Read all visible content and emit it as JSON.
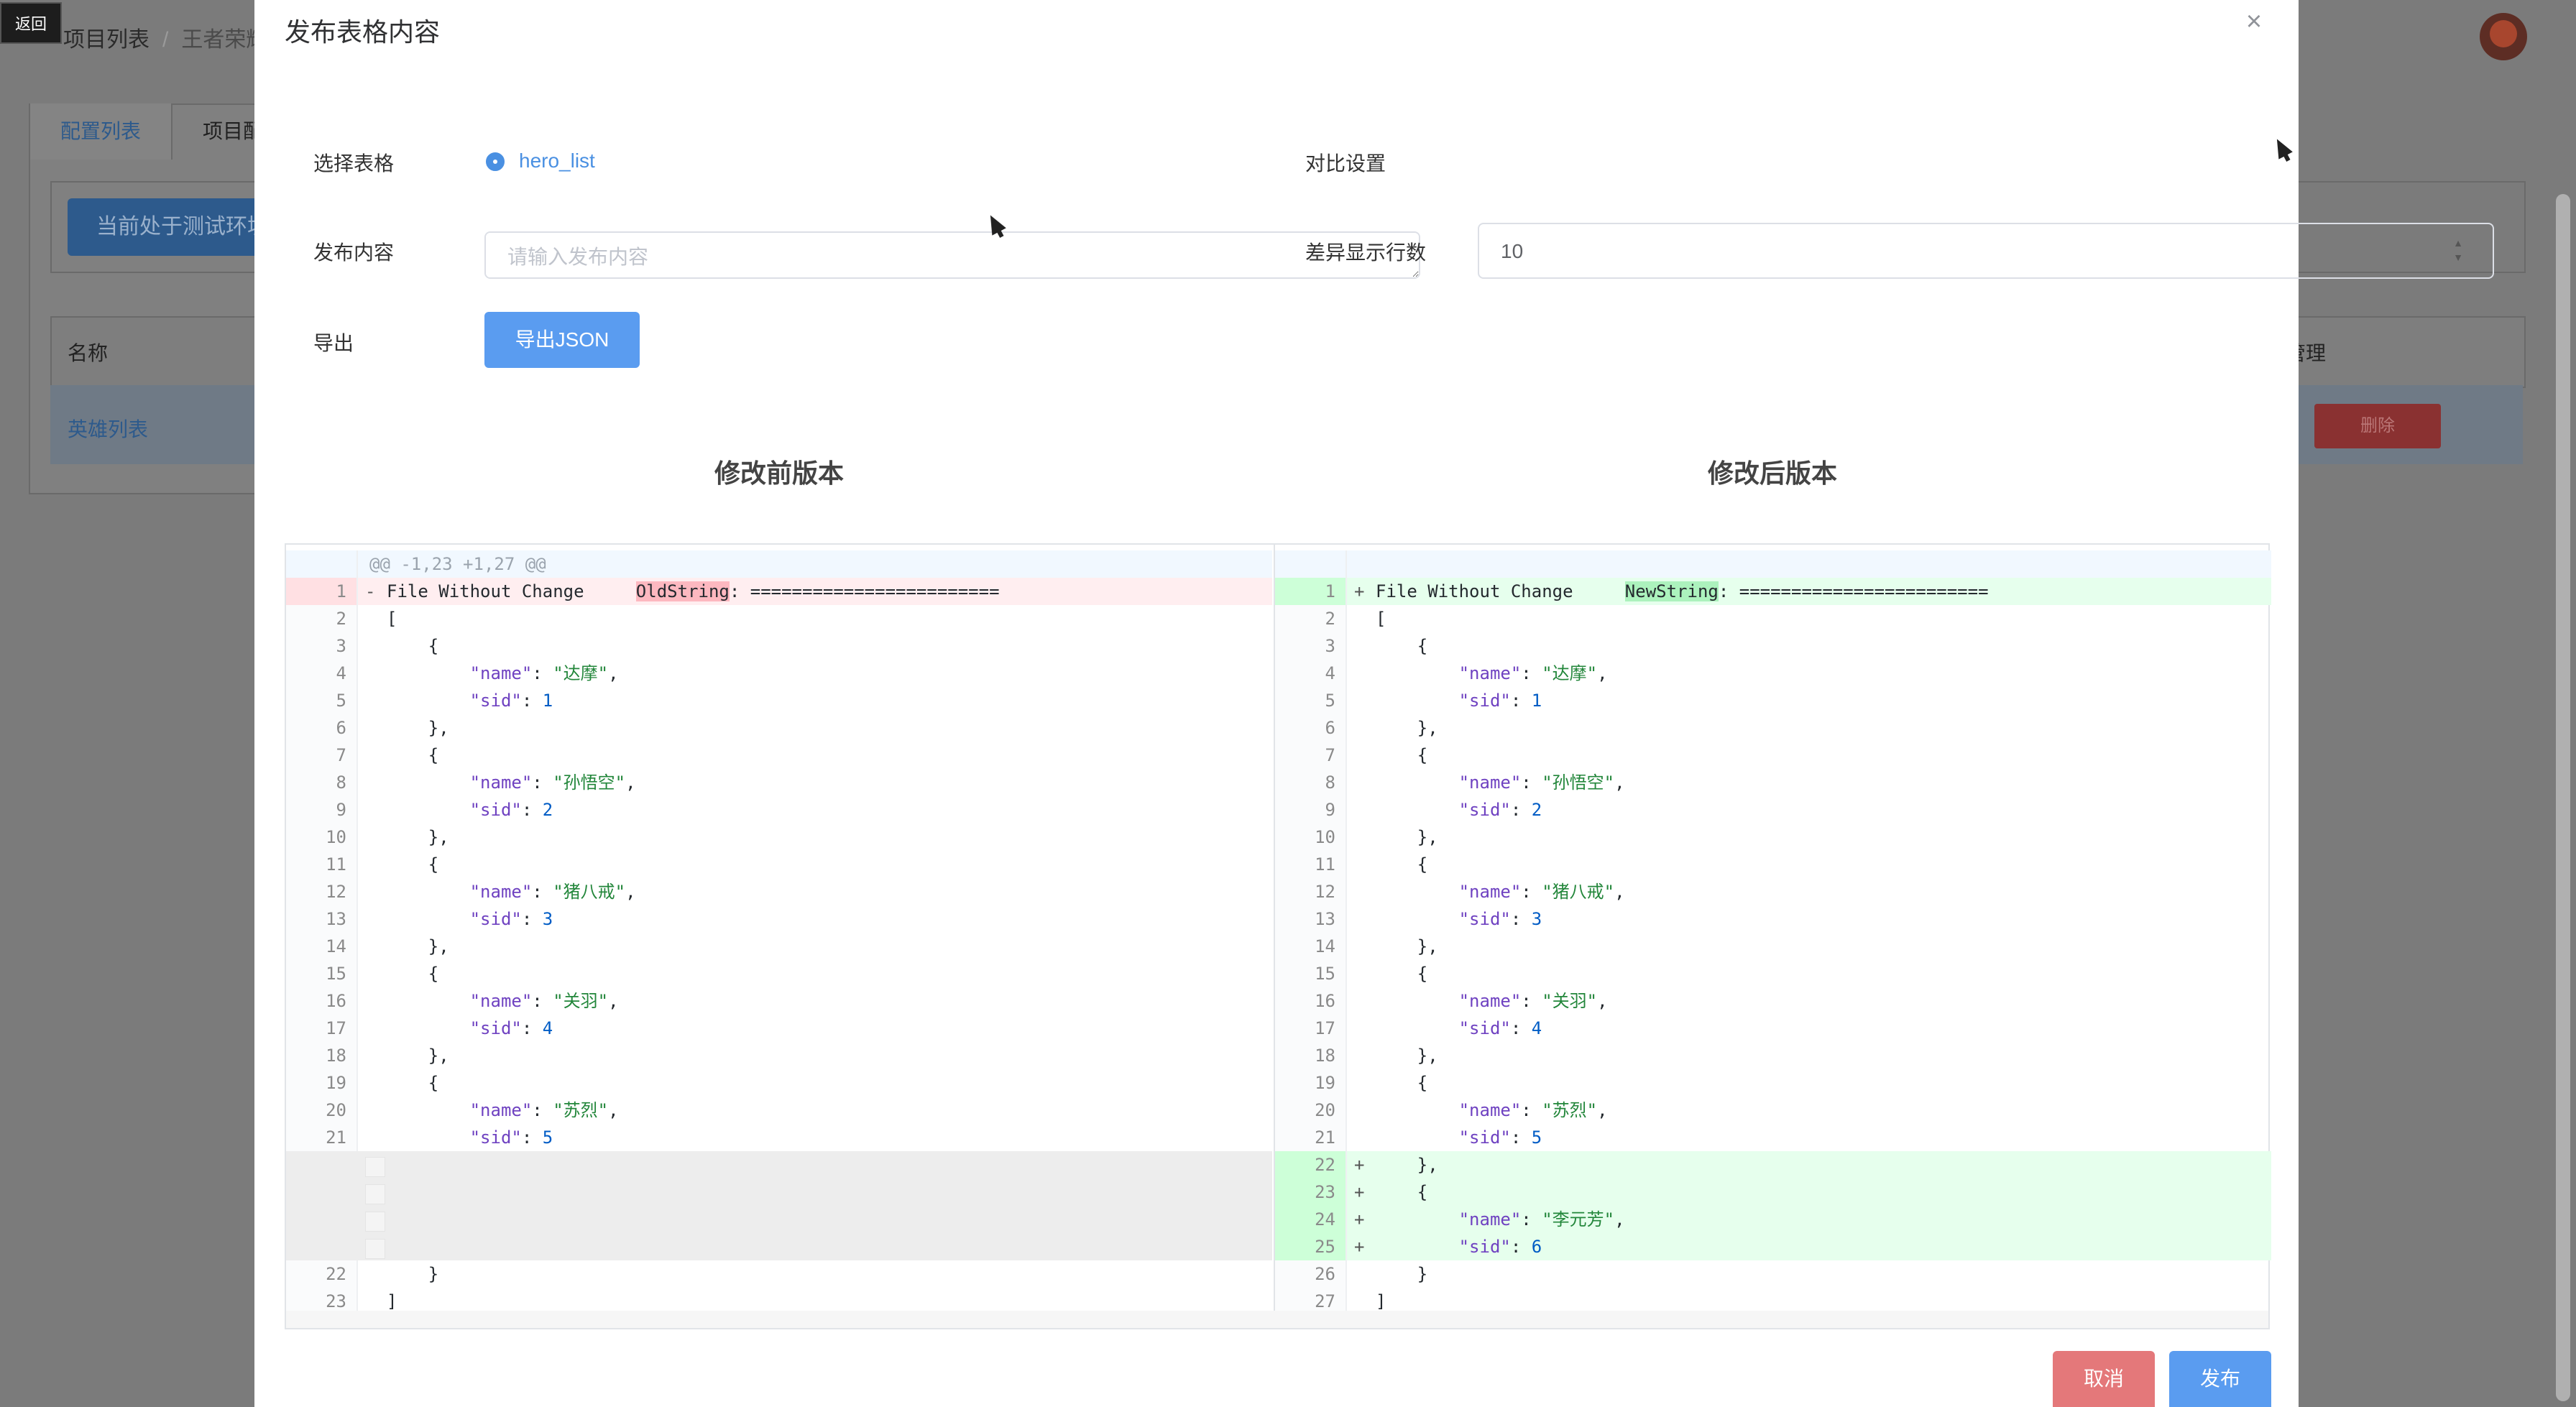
{
  "background": {
    "back_label": "返回",
    "breadcrumb": {
      "first": "项目列表",
      "separator": "/",
      "current": "王者荣耀"
    },
    "tabs": [
      "配置列表",
      "项目配置"
    ],
    "env_button": "当前处于测试环境",
    "table": {
      "col_name": "名称",
      "col_manage": "管理",
      "row_name": "英雄列表",
      "delete_label": "删除"
    }
  },
  "modal": {
    "title": "发布表格内容",
    "close_icon": "close-icon",
    "labels": {
      "select_table": "选择表格",
      "compare_settings": "对比设置",
      "publish_content": "发布内容",
      "diff_lines": "差异显示行数",
      "export": "导出"
    },
    "selected_table": "hero_list",
    "publish_content": {
      "value": "",
      "placeholder": "请输入发布内容"
    },
    "diff_lines_value": "10",
    "export_button": "导出JSON",
    "before_title": "修改前版本",
    "after_title": "修改后版本",
    "cancel_button": "取消",
    "publish_button": "发布"
  },
  "diff": {
    "hunk_header": "@@ -1,23 +1,27 @@",
    "left": [
      {
        "n": "1",
        "t": "del",
        "m": "-",
        "parts": [
          [
            "",
            "File "
          ],
          [
            "",
            "Without Change     "
          ],
          [
            "hl-del",
            "OldString"
          ],
          [
            "",
            ": ========================"
          ]
        ]
      },
      {
        "n": "2",
        "t": "ctx",
        "parts": [
          [
            "",
            "["
          ]
        ]
      },
      {
        "n": "3",
        "t": "ctx",
        "parts": [
          [
            "",
            "    {"
          ]
        ]
      },
      {
        "n": "4",
        "t": "ctx",
        "parts": [
          [
            "",
            "        "
          ],
          [
            "k",
            "\"name\""
          ],
          [
            "",
            ": "
          ],
          [
            "s",
            "\"达摩\""
          ],
          [
            "",
            ","
          ]
        ]
      },
      {
        "n": "5",
        "t": "ctx",
        "parts": [
          [
            "",
            "        "
          ],
          [
            "k",
            "\"sid\""
          ],
          [
            "",
            ": "
          ],
          [
            "n",
            "1"
          ]
        ]
      },
      {
        "n": "6",
        "t": "ctx",
        "parts": [
          [
            "",
            "    },"
          ]
        ]
      },
      {
        "n": "7",
        "t": "ctx",
        "parts": [
          [
            "",
            "    {"
          ]
        ]
      },
      {
        "n": "8",
        "t": "ctx",
        "parts": [
          [
            "",
            "        "
          ],
          [
            "k",
            "\"name\""
          ],
          [
            "",
            ": "
          ],
          [
            "s",
            "\"孙悟空\""
          ],
          [
            "",
            ","
          ]
        ]
      },
      {
        "n": "9",
        "t": "ctx",
        "parts": [
          [
            "",
            "        "
          ],
          [
            "k",
            "\"sid\""
          ],
          [
            "",
            ": "
          ],
          [
            "n",
            "2"
          ]
        ]
      },
      {
        "n": "10",
        "t": "ctx",
        "parts": [
          [
            "",
            "    },"
          ]
        ]
      },
      {
        "n": "11",
        "t": "ctx",
        "parts": [
          [
            "",
            "    {"
          ]
        ]
      },
      {
        "n": "12",
        "t": "ctx",
        "parts": [
          [
            "",
            "        "
          ],
          [
            "k",
            "\"name\""
          ],
          [
            "",
            ": "
          ],
          [
            "s",
            "\"猪八戒\""
          ],
          [
            "",
            ","
          ]
        ]
      },
      {
        "n": "13",
        "t": "ctx",
        "parts": [
          [
            "",
            "        "
          ],
          [
            "k",
            "\"sid\""
          ],
          [
            "",
            ": "
          ],
          [
            "n",
            "3"
          ]
        ]
      },
      {
        "n": "14",
        "t": "ctx",
        "parts": [
          [
            "",
            "    },"
          ]
        ]
      },
      {
        "n": "15",
        "t": "ctx",
        "parts": [
          [
            "",
            "    {"
          ]
        ]
      },
      {
        "n": "16",
        "t": "ctx",
        "parts": [
          [
            "",
            "        "
          ],
          [
            "k",
            "\"name\""
          ],
          [
            "",
            ": "
          ],
          [
            "s",
            "\"关羽\""
          ],
          [
            "",
            ","
          ]
        ]
      },
      {
        "n": "17",
        "t": "ctx",
        "parts": [
          [
            "",
            "        "
          ],
          [
            "k",
            "\"sid\""
          ],
          [
            "",
            ": "
          ],
          [
            "n",
            "4"
          ]
        ]
      },
      {
        "n": "18",
        "t": "ctx",
        "parts": [
          [
            "",
            "    },"
          ]
        ]
      },
      {
        "n": "19",
        "t": "ctx",
        "parts": [
          [
            "",
            "    {"
          ]
        ]
      },
      {
        "n": "20",
        "t": "ctx",
        "parts": [
          [
            "",
            "        "
          ],
          [
            "k",
            "\"name\""
          ],
          [
            "",
            ": "
          ],
          [
            "s",
            "\"苏烈\""
          ],
          [
            "",
            ","
          ]
        ]
      },
      {
        "n": "21",
        "t": "ctx",
        "parts": [
          [
            "",
            "        "
          ],
          [
            "k",
            "\"sid\""
          ],
          [
            "",
            ": "
          ],
          [
            "n",
            "5"
          ]
        ]
      },
      {
        "n": "",
        "t": "empty",
        "parts": []
      },
      {
        "n": "",
        "t": "empty",
        "parts": []
      },
      {
        "n": "",
        "t": "empty",
        "parts": []
      },
      {
        "n": "",
        "t": "empty",
        "parts": []
      },
      {
        "n": "22",
        "t": "ctx",
        "parts": [
          [
            "",
            "    }"
          ]
        ]
      },
      {
        "n": "23",
        "t": "ctx",
        "parts": [
          [
            "",
            "]"
          ]
        ]
      }
    ],
    "right": [
      {
        "n": "1",
        "t": "add",
        "m": "+",
        "parts": [
          [
            "",
            "File "
          ],
          [
            "",
            "Without Change     "
          ],
          [
            "hl-add",
            "NewString"
          ],
          [
            "",
            ": ========================"
          ]
        ]
      },
      {
        "n": "2",
        "t": "ctx",
        "parts": [
          [
            "",
            "["
          ]
        ]
      },
      {
        "n": "3",
        "t": "ctx",
        "parts": [
          [
            "",
            "    {"
          ]
        ]
      },
      {
        "n": "4",
        "t": "ctx",
        "parts": [
          [
            "",
            "        "
          ],
          [
            "k",
            "\"name\""
          ],
          [
            "",
            ": "
          ],
          [
            "s",
            "\"达摩\""
          ],
          [
            "",
            ","
          ]
        ]
      },
      {
        "n": "5",
        "t": "ctx",
        "parts": [
          [
            "",
            "        "
          ],
          [
            "k",
            "\"sid\""
          ],
          [
            "",
            ": "
          ],
          [
            "n",
            "1"
          ]
        ]
      },
      {
        "n": "6",
        "t": "ctx",
        "parts": [
          [
            "",
            "    },"
          ]
        ]
      },
      {
        "n": "7",
        "t": "ctx",
        "parts": [
          [
            "",
            "    {"
          ]
        ]
      },
      {
        "n": "8",
        "t": "ctx",
        "parts": [
          [
            "",
            "        "
          ],
          [
            "k",
            "\"name\""
          ],
          [
            "",
            ": "
          ],
          [
            "s",
            "\"孙悟空\""
          ],
          [
            "",
            ","
          ]
        ]
      },
      {
        "n": "9",
        "t": "ctx",
        "parts": [
          [
            "",
            "        "
          ],
          [
            "k",
            "\"sid\""
          ],
          [
            "",
            ": "
          ],
          [
            "n",
            "2"
          ]
        ]
      },
      {
        "n": "10",
        "t": "ctx",
        "parts": [
          [
            "",
            "    },"
          ]
        ]
      },
      {
        "n": "11",
        "t": "ctx",
        "parts": [
          [
            "",
            "    {"
          ]
        ]
      },
      {
        "n": "12",
        "t": "ctx",
        "parts": [
          [
            "",
            "        "
          ],
          [
            "k",
            "\"name\""
          ],
          [
            "",
            ": "
          ],
          [
            "s",
            "\"猪八戒\""
          ],
          [
            "",
            ","
          ]
        ]
      },
      {
        "n": "13",
        "t": "ctx",
        "parts": [
          [
            "",
            "        "
          ],
          [
            "k",
            "\"sid\""
          ],
          [
            "",
            ": "
          ],
          [
            "n",
            "3"
          ]
        ]
      },
      {
        "n": "14",
        "t": "ctx",
        "parts": [
          [
            "",
            "    },"
          ]
        ]
      },
      {
        "n": "15",
        "t": "ctx",
        "parts": [
          [
            "",
            "    {"
          ]
        ]
      },
      {
        "n": "16",
        "t": "ctx",
        "parts": [
          [
            "",
            "        "
          ],
          [
            "k",
            "\"name\""
          ],
          [
            "",
            ": "
          ],
          [
            "s",
            "\"关羽\""
          ],
          [
            "",
            ","
          ]
        ]
      },
      {
        "n": "17",
        "t": "ctx",
        "parts": [
          [
            "",
            "        "
          ],
          [
            "k",
            "\"sid\""
          ],
          [
            "",
            ": "
          ],
          [
            "n",
            "4"
          ]
        ]
      },
      {
        "n": "18",
        "t": "ctx",
        "parts": [
          [
            "",
            "    },"
          ]
        ]
      },
      {
        "n": "19",
        "t": "ctx",
        "parts": [
          [
            "",
            "    {"
          ]
        ]
      },
      {
        "n": "20",
        "t": "ctx",
        "parts": [
          [
            "",
            "        "
          ],
          [
            "k",
            "\"name\""
          ],
          [
            "",
            ": "
          ],
          [
            "s",
            "\"苏烈\""
          ],
          [
            "",
            ","
          ]
        ]
      },
      {
        "n": "21",
        "t": "ctx",
        "parts": [
          [
            "",
            "        "
          ],
          [
            "k",
            "\"sid\""
          ],
          [
            "",
            ": "
          ],
          [
            "n",
            "5"
          ]
        ]
      },
      {
        "n": "22",
        "t": "add",
        "m": "+",
        "parts": [
          [
            "",
            "    },"
          ]
        ]
      },
      {
        "n": "23",
        "t": "add",
        "m": "+",
        "parts": [
          [
            "",
            "    {"
          ]
        ]
      },
      {
        "n": "24",
        "t": "add",
        "m": "+",
        "parts": [
          [
            "",
            "        "
          ],
          [
            "k",
            "\"name\""
          ],
          [
            "",
            ": "
          ],
          [
            "s",
            "\"李元芳\""
          ],
          [
            "",
            ","
          ]
        ]
      },
      {
        "n": "25",
        "t": "add",
        "m": "+",
        "parts": [
          [
            "",
            "        "
          ],
          [
            "k",
            "\"sid\""
          ],
          [
            "",
            ": "
          ],
          [
            "n",
            "6"
          ]
        ]
      },
      {
        "n": "26",
        "t": "ctx",
        "parts": [
          [
            "",
            "    }"
          ]
        ]
      },
      {
        "n": "27",
        "t": "ctx",
        "parts": [
          [
            "",
            "]"
          ]
        ]
      }
    ]
  }
}
